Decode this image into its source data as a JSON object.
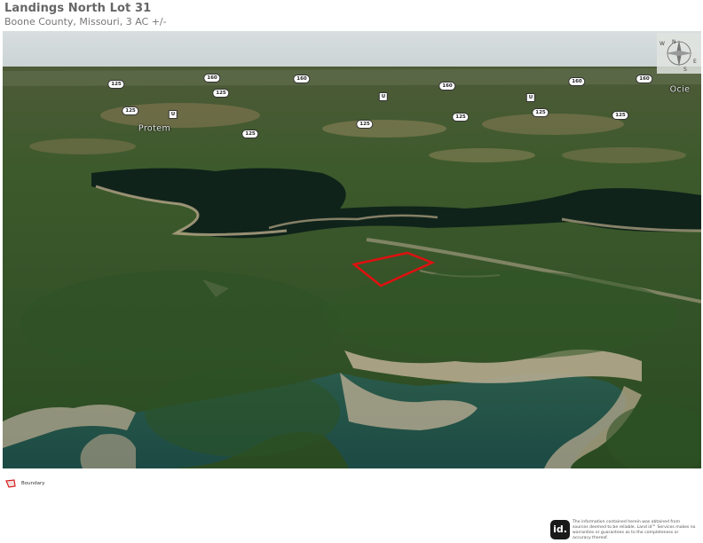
{
  "header": {
    "title": "Landings North Lot 31",
    "subtitle": "Boone County, Missouri, 3 AC +/-"
  },
  "map": {
    "road_shields": [
      {
        "label": "125",
        "type": "state"
      },
      {
        "label": "160",
        "type": "us"
      },
      {
        "label": "160",
        "type": "us"
      },
      {
        "label": "125",
        "type": "state"
      },
      {
        "label": "125",
        "type": "state"
      },
      {
        "label": "U",
        "type": "letter"
      },
      {
        "label": "U",
        "type": "letter"
      },
      {
        "label": "160",
        "type": "us"
      },
      {
        "label": "U",
        "type": "letter"
      },
      {
        "label": "160",
        "type": "us"
      },
      {
        "label": "160",
        "type": "us"
      },
      {
        "label": "125",
        "type": "state"
      },
      {
        "label": "125",
        "type": "state"
      },
      {
        "label": "125",
        "type": "state"
      },
      {
        "label": "125",
        "type": "state"
      },
      {
        "label": "125",
        "type": "state"
      }
    ],
    "places": [
      "Protem",
      "Ocie"
    ],
    "compass": {
      "icon": "compass-rose-icon",
      "letters": [
        "N",
        "E",
        "S",
        "W"
      ]
    },
    "boundary_color": "#e01010"
  },
  "legend": {
    "items": [
      {
        "label": "Boundary",
        "color": "#d62020"
      }
    ]
  },
  "footer": {
    "logo_text": "id.",
    "disclaimer": "The information contained herein was obtained from sources deemed to be reliable. Land id™ Services makes no warranties or guarantees as to the completeness or accuracy thereof."
  }
}
